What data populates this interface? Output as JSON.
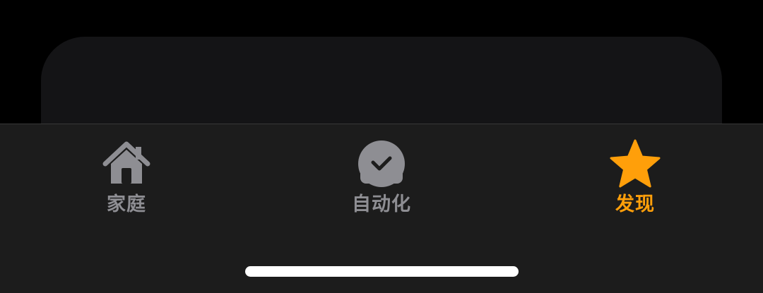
{
  "tabbar": {
    "tabs": [
      {
        "label": "家庭",
        "icon": "house-icon",
        "selected": false
      },
      {
        "label": "自动化",
        "icon": "clock-check-icon",
        "selected": false
      },
      {
        "label": "发现",
        "icon": "star-icon",
        "selected": true
      }
    ]
  },
  "colors": {
    "inactive": "#8e8e93",
    "active": "#ff9f0a",
    "tabbar_background": "#1c1c1c",
    "card_background": "#141416",
    "page_background": "#000000",
    "home_indicator": "#ffffff"
  }
}
